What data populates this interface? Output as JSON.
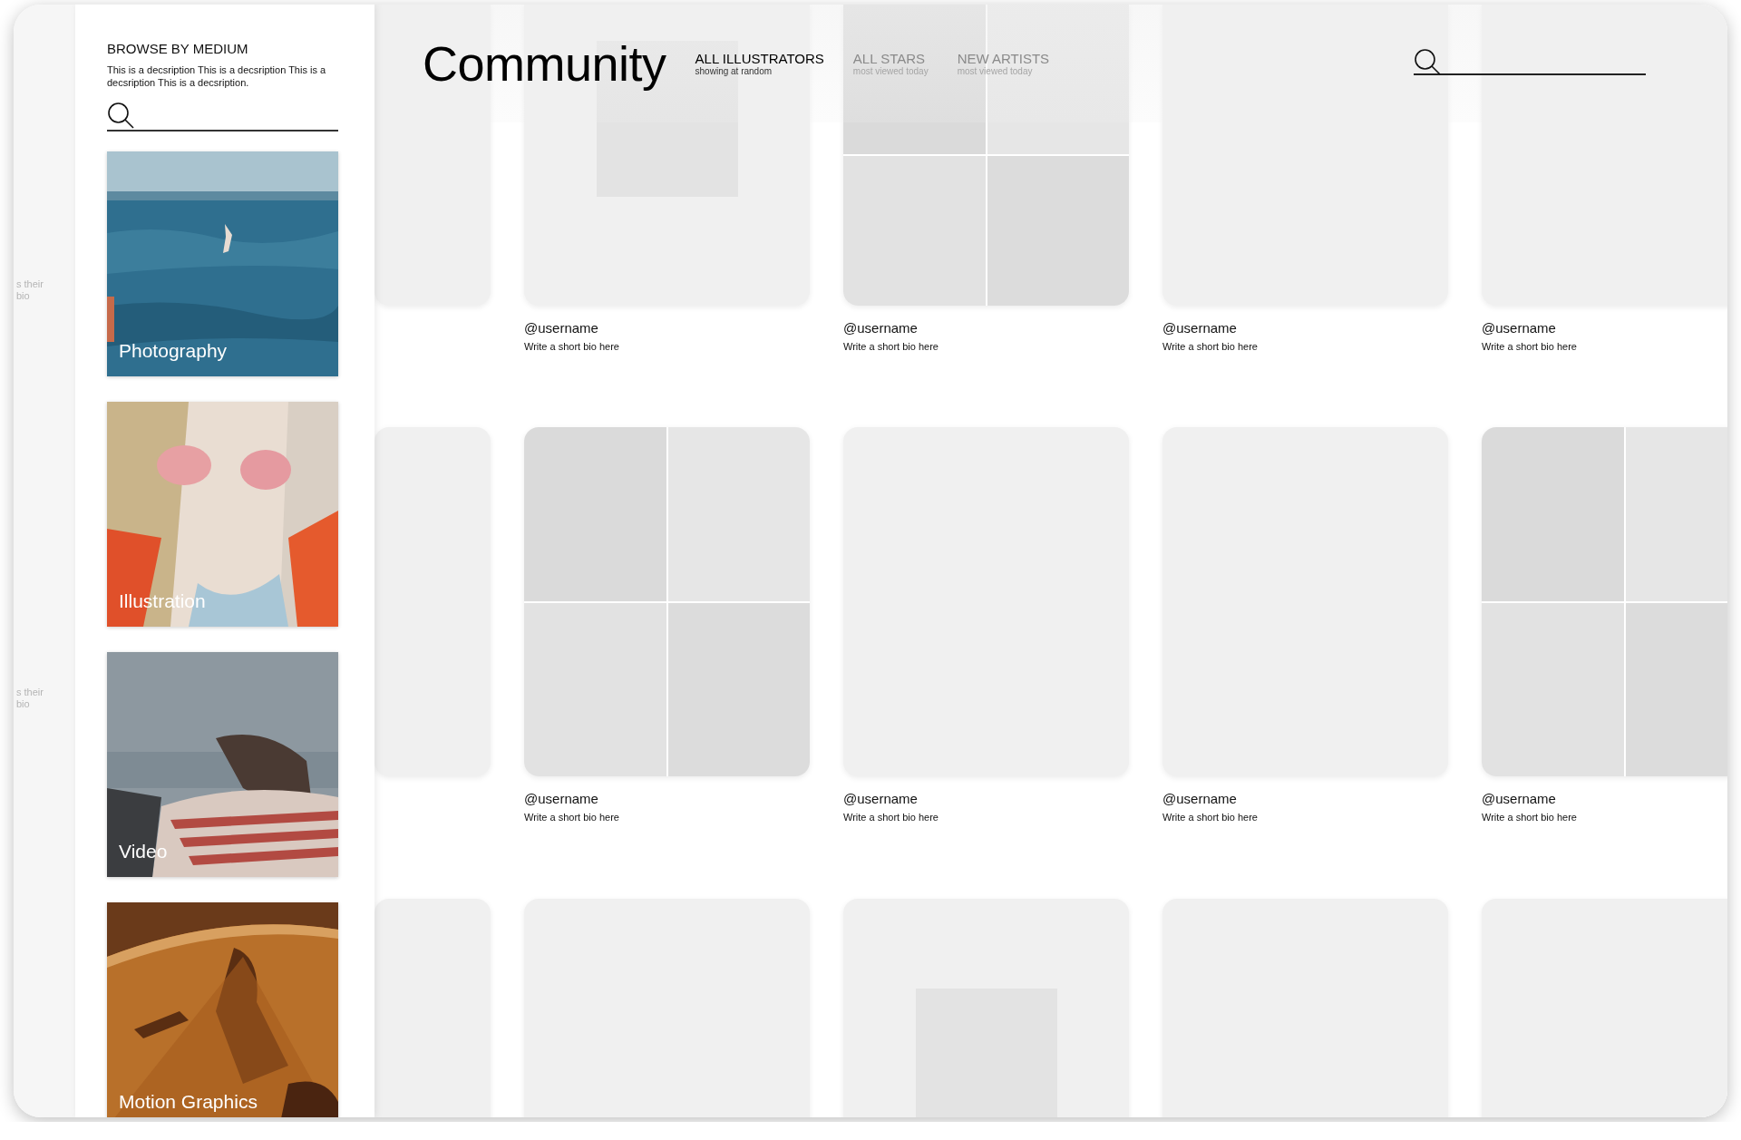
{
  "sidebar": {
    "title": "BROWSE BY MEDIUM",
    "description": "This is a decsription This is a decsription This is a decsription This is a decsription.",
    "mediums": [
      {
        "label": "Photography"
      },
      {
        "label": "Illustration"
      },
      {
        "label": "Video"
      },
      {
        "label": "Motion Graphics"
      }
    ]
  },
  "header": {
    "title": "Community",
    "tabs": [
      {
        "label": "ALL ILLUSTRATORS",
        "sublabel": "showing at random",
        "selected": true
      },
      {
        "label": "ALL STARS",
        "sublabel": "most viewed today",
        "selected": false
      },
      {
        "label": "NEW ARTISTS",
        "sublabel": "most viewed today",
        "selected": false
      }
    ]
  },
  "rows": [
    {
      "fragment_lines": [
        "s their",
        "bio"
      ],
      "cards": [
        {
          "kind": "blank"
        },
        {
          "kind": "inset",
          "username": "@username",
          "bio": "Write a short bio here"
        },
        {
          "kind": "grid",
          "username": "@username",
          "bio": "Write a short bio here"
        },
        {
          "kind": "blank",
          "username": "@username",
          "bio": "Write a short bio here"
        },
        {
          "kind": "blank",
          "username": "@username",
          "bio": "Write a short bio here"
        }
      ]
    },
    {
      "fragment_lines": [
        "s their",
        "bio"
      ],
      "cards": [
        {
          "kind": "blank"
        },
        {
          "kind": "grid",
          "username": "@username",
          "bio": "Write a short bio here"
        },
        {
          "kind": "blank",
          "username": "@username",
          "bio": "Write a short bio here"
        },
        {
          "kind": "blank",
          "username": "@username",
          "bio": "Write a short bio here"
        },
        {
          "kind": "grid",
          "username": "@username",
          "bio": "Write a short bio here"
        }
      ]
    },
    {
      "cards": [
        {
          "kind": "blank"
        },
        {
          "kind": "blank"
        },
        {
          "kind": "lowinset"
        },
        {
          "kind": "blank"
        },
        {
          "kind": "blank"
        }
      ]
    }
  ]
}
